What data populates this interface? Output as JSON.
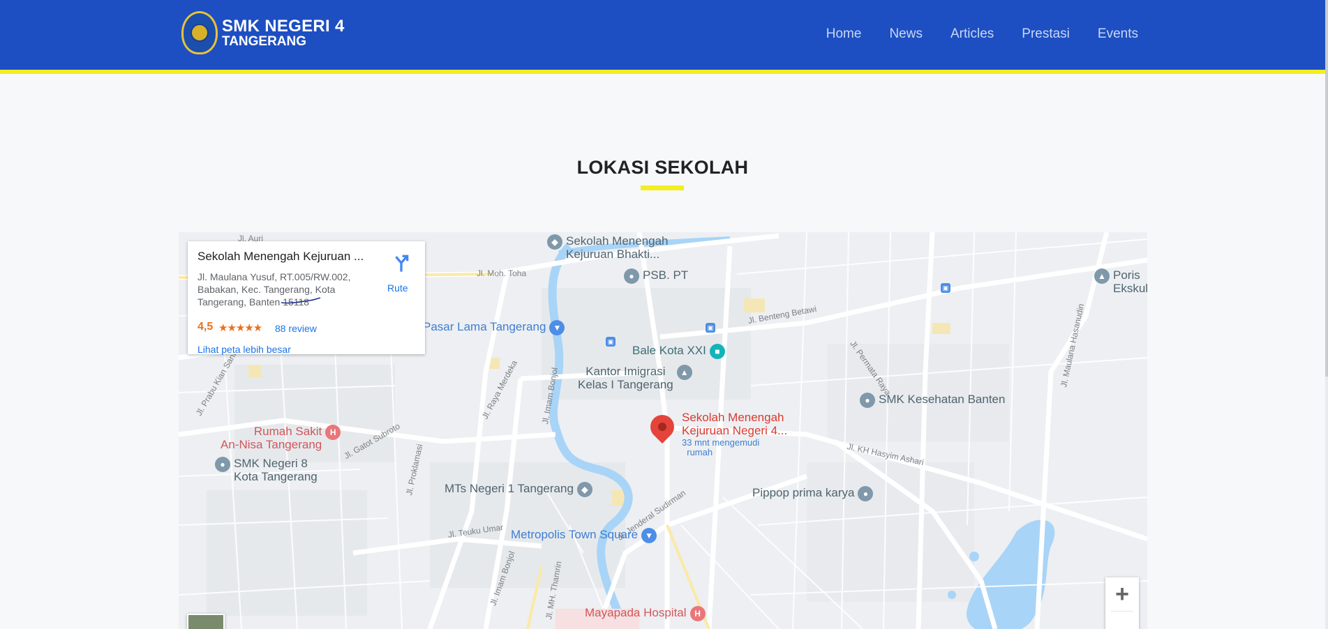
{
  "header": {
    "brand_line1": "SMK NEGERI 4",
    "brand_line2": "TANGERANG",
    "logo_icon": "school-crest-logo",
    "nav": [
      "Home",
      "News",
      "Articles",
      "Prestasi",
      "Events"
    ]
  },
  "section": {
    "title": "LOKASI SEKOLAH"
  },
  "map": {
    "info_card": {
      "name": "Sekolah Menengah Kejuruan ...",
      "address": "Jl. Maulana Yusuf, RT.005/RW.002, Babakan, Kec. Tangerang, Kota Tangerang, Banten 15118",
      "rating": "4,5",
      "stars": "★★★★★",
      "reviews": "88 review",
      "larger_map": "Lihat peta lebih besar",
      "route_label": "Rute",
      "route_icon": "directions-icon"
    },
    "main_marker": {
      "line1": "Sekolah Menengah",
      "line2": "Kejuruan Negeri 4...",
      "sub1": "33 mnt mengemudi",
      "sub2": "rumah"
    },
    "pois": {
      "bhakti_1": "Sekolah Menengah",
      "bhakti_2": "Kejuruan Bhakti...",
      "psb": "PSB. PT",
      "poris_1": "Poris",
      "poris_2": "Ekskul",
      "pasar": "Pasar Lama Tangerang",
      "bale": "Bale Kota XXI",
      "imigrasi_1": "Kantor Imigrasi",
      "imigrasi_2": "Kelas I Tangerang",
      "smk_kes": "SMK Kesehatan Banten",
      "rs_1": "Rumah Sakit",
      "rs_2": "An-Nisa Tangerang",
      "smk8_1": "SMK Negeri 8",
      "smk8_2": "Kota Tangerang",
      "mts": "MTs Negeri 1 Tangerang",
      "pippop": "Pippop prima karya",
      "metropolis": "Metropolis Town Square",
      "mayapada": "Mayapada Hospital"
    },
    "roads": {
      "moh_toha": "Jl. Moh. Toha",
      "benteng": "Jl. Benteng Betawi",
      "permata": "Jl. Permata Raya",
      "maulana": "Jl. Maulana Hasanudin",
      "prabu": "Jl. Prabu Kian Santang",
      "merdeka": "Jl. Raya Merdeka",
      "bonjol": "Jl. Imam Bonjol",
      "gatot": "Jl. Gatot Subroto",
      "hasyim": "Jl. KH Hasyim Ashari",
      "proklamasi": "Jl. Proklamasi",
      "teuku": "Jl. Teuku Umar",
      "sudirman": "Jl. Jenderal Sudirman",
      "bonjol2": "Jl. Imam Bonjol",
      "thamrin": "Jl. MH. Thamrin",
      "aut": "Jl. Auri"
    },
    "zoom_in": "+"
  }
}
